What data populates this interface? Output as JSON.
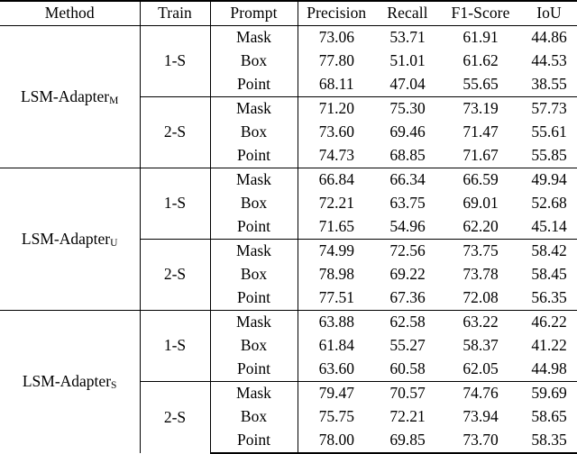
{
  "table": {
    "headers": {
      "method": "Method",
      "train": "Train",
      "prompt": "Prompt",
      "precision": "Precision",
      "recall": "Recall",
      "f1": "F1-Score",
      "iou": "IoU"
    },
    "blocks": [
      {
        "method_base": "LSM-Adapter",
        "method_sub": "M",
        "groups": [
          {
            "train": "1-S",
            "rows": [
              {
                "prompt": "Mask",
                "precision": "73.06",
                "recall": "53.71",
                "f1": "61.91",
                "iou": "44.86",
                "bold": [
                  "f1",
                  "iou"
                ]
              },
              {
                "prompt": "Box",
                "precision": "77.80",
                "recall": "51.01",
                "f1": "61.62",
                "iou": "44.53",
                "bold": []
              },
              {
                "prompt": "Point",
                "precision": "68.11",
                "recall": "47.04",
                "f1": "55.65",
                "iou": "38.55",
                "bold": []
              }
            ]
          },
          {
            "train": "2-S",
            "rows": [
              {
                "prompt": "Mask",
                "precision": "71.20",
                "recall": "75.30",
                "f1": "73.19",
                "iou": "57.73",
                "bold": [
                  "f1",
                  "iou"
                ]
              },
              {
                "prompt": "Box",
                "precision": "73.60",
                "recall": "69.46",
                "f1": "71.47",
                "iou": "55.61",
                "bold": []
              },
              {
                "prompt": "Point",
                "precision": "74.73",
                "recall": "68.85",
                "f1": "71.67",
                "iou": "55.85",
                "bold": []
              }
            ]
          }
        ]
      },
      {
        "method_base": "LSM-Adapter",
        "method_sub": "U",
        "groups": [
          {
            "train": "1-S",
            "rows": [
              {
                "prompt": "Mask",
                "precision": "66.84",
                "recall": "66.34",
                "f1": "66.59",
                "iou": "49.94",
                "bold": []
              },
              {
                "prompt": "Box",
                "precision": "72.21",
                "recall": "63.75",
                "f1": "69.01",
                "iou": "52.68",
                "bold": [
                  "f1",
                  "iou"
                ]
              },
              {
                "prompt": "Point",
                "precision": "71.65",
                "recall": "54.96",
                "f1": "62.20",
                "iou": "45.14",
                "bold": []
              }
            ]
          },
          {
            "train": "2-S",
            "rows": [
              {
                "prompt": "Mask",
                "precision": "74.99",
                "recall": "72.56",
                "f1": "73.75",
                "iou": "58.42",
                "bold": []
              },
              {
                "prompt": "Box",
                "precision": "78.98",
                "recall": "69.22",
                "f1": "73.78",
                "iou": "58.45",
                "bold": [
                  "f1",
                  "iou"
                ]
              },
              {
                "prompt": "Point",
                "precision": "77.51",
                "recall": "67.36",
                "f1": "72.08",
                "iou": "56.35",
                "bold": []
              }
            ]
          }
        ]
      },
      {
        "method_base": "LSM-Adapter",
        "method_sub": "S",
        "groups": [
          {
            "train": "1-S",
            "rows": [
              {
                "prompt": "Mask",
                "precision": "63.88",
                "recall": "62.58",
                "f1": "63.22",
                "iou": "46.22",
                "bold": [
                  "f1",
                  "iou"
                ]
              },
              {
                "prompt": "Box",
                "precision": "61.84",
                "recall": "55.27",
                "f1": "58.37",
                "iou": "41.22",
                "bold": []
              },
              {
                "prompt": "Point",
                "precision": "63.60",
                "recall": "60.58",
                "f1": "62.05",
                "iou": "44.98",
                "bold": []
              }
            ]
          },
          {
            "train": "2-S",
            "rows": [
              {
                "prompt": "Mask",
                "precision": "79.47",
                "recall": "70.57",
                "f1": "74.76",
                "iou": "59.69",
                "bold": [
                  "f1",
                  "iou"
                ]
              },
              {
                "prompt": "Box",
                "precision": "75.75",
                "recall": "72.21",
                "f1": "73.94",
                "iou": "58.65",
                "bold": []
              },
              {
                "prompt": "Point",
                "precision": "78.00",
                "recall": "69.85",
                "f1": "73.70",
                "iou": "58.35",
                "bold": []
              }
            ]
          }
        ]
      }
    ]
  }
}
